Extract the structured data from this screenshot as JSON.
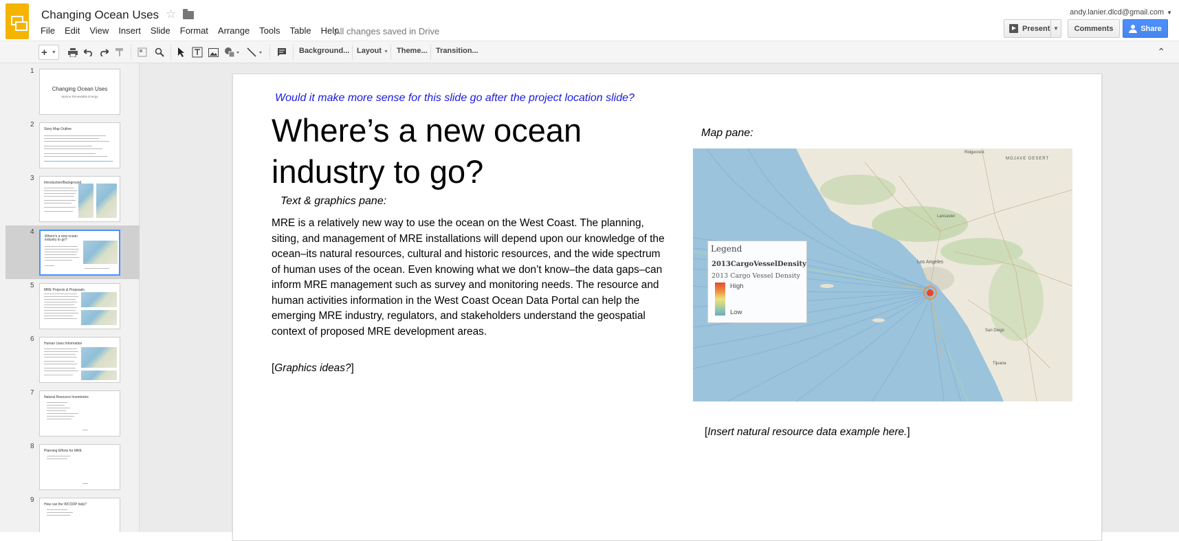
{
  "app": {
    "title": "Changing Ocean Uses",
    "save_status": "All changes saved in Drive",
    "user_email": "andy.lanier.dlcd@gmail.com",
    "accent_color": "#f4b400",
    "share_color": "#4d90fe"
  },
  "menu": [
    "File",
    "Edit",
    "View",
    "Insert",
    "Slide",
    "Format",
    "Arrange",
    "Tools",
    "Table",
    "Help"
  ],
  "header_buttons": {
    "present": "Present",
    "comments": "Comments",
    "share": "Share"
  },
  "toolbar": {
    "background": "Background...",
    "layout": "Layout",
    "theme": "Theme...",
    "transition": "Transition..."
  },
  "filmstrip": [
    {
      "num": "1",
      "title": "Changing Ocean Uses",
      "subtitle": "Marine Renewable Energy"
    },
    {
      "num": "2",
      "title": "Story Map Outline"
    },
    {
      "num": "3",
      "title": "Introduction/Background"
    },
    {
      "num": "4",
      "title": "Where's a new ocean industry to go?",
      "selected": true
    },
    {
      "num": "5",
      "title": "MRE Projects & Proposals"
    },
    {
      "num": "6",
      "title": "Human Uses Information"
    },
    {
      "num": "7",
      "title": "Natural Resource Inventories"
    },
    {
      "num": "8",
      "title": "Planning Efforts for MRE"
    },
    {
      "num": "9",
      "title": "How can the WCODP help?"
    }
  ],
  "slide": {
    "comment": "Would it make more sense for this slide go after the project location slide?",
    "heading": "Where’s a new ocean industry to go?",
    "text_pane_label": "Text & graphics pane:",
    "body": "MRE is a relatively new way to use the ocean on the West Coast. The planning, siting, and management of MRE installations will depend upon our knowledge of the ocean–its natural resources, cultural and historic resources, and the wide spectrum of human uses of the ocean. Even knowing what we don’t know–the data gaps–can inform MRE management such as survey and monitoring needs. The resource and human activities information in the West Coast Ocean Data Portal can help the emerging MRE industry, regulators, and stakeholders understand the geospatial context of proposed MRE development areas.",
    "graphics_ideas_open": "[",
    "graphics_ideas": "Graphics ideas?",
    "graphics_ideas_close": "]",
    "map_pane_label": "Map pane:",
    "insert_note_open": "[",
    "insert_note": "Insert natural resource data example here.",
    "insert_note_close": "]"
  },
  "legend": {
    "title": "Legend",
    "layer": "2013CargoVesselDensity",
    "subtitle": "2013 Cargo Vessel Density",
    "high": "High",
    "low": "Low",
    "colors": [
      "#e8462b",
      "#f08a3a",
      "#f4e27a",
      "#a8d09a",
      "#6aa8c8"
    ]
  },
  "map_labels": {
    "desert": "MOJAVE DESERT",
    "la": "Los Angeles",
    "sd": "San Diego",
    "tj": "Tijuana",
    "lancaster": "Lancaster",
    "ridgecrest": "Ridgecrest"
  }
}
